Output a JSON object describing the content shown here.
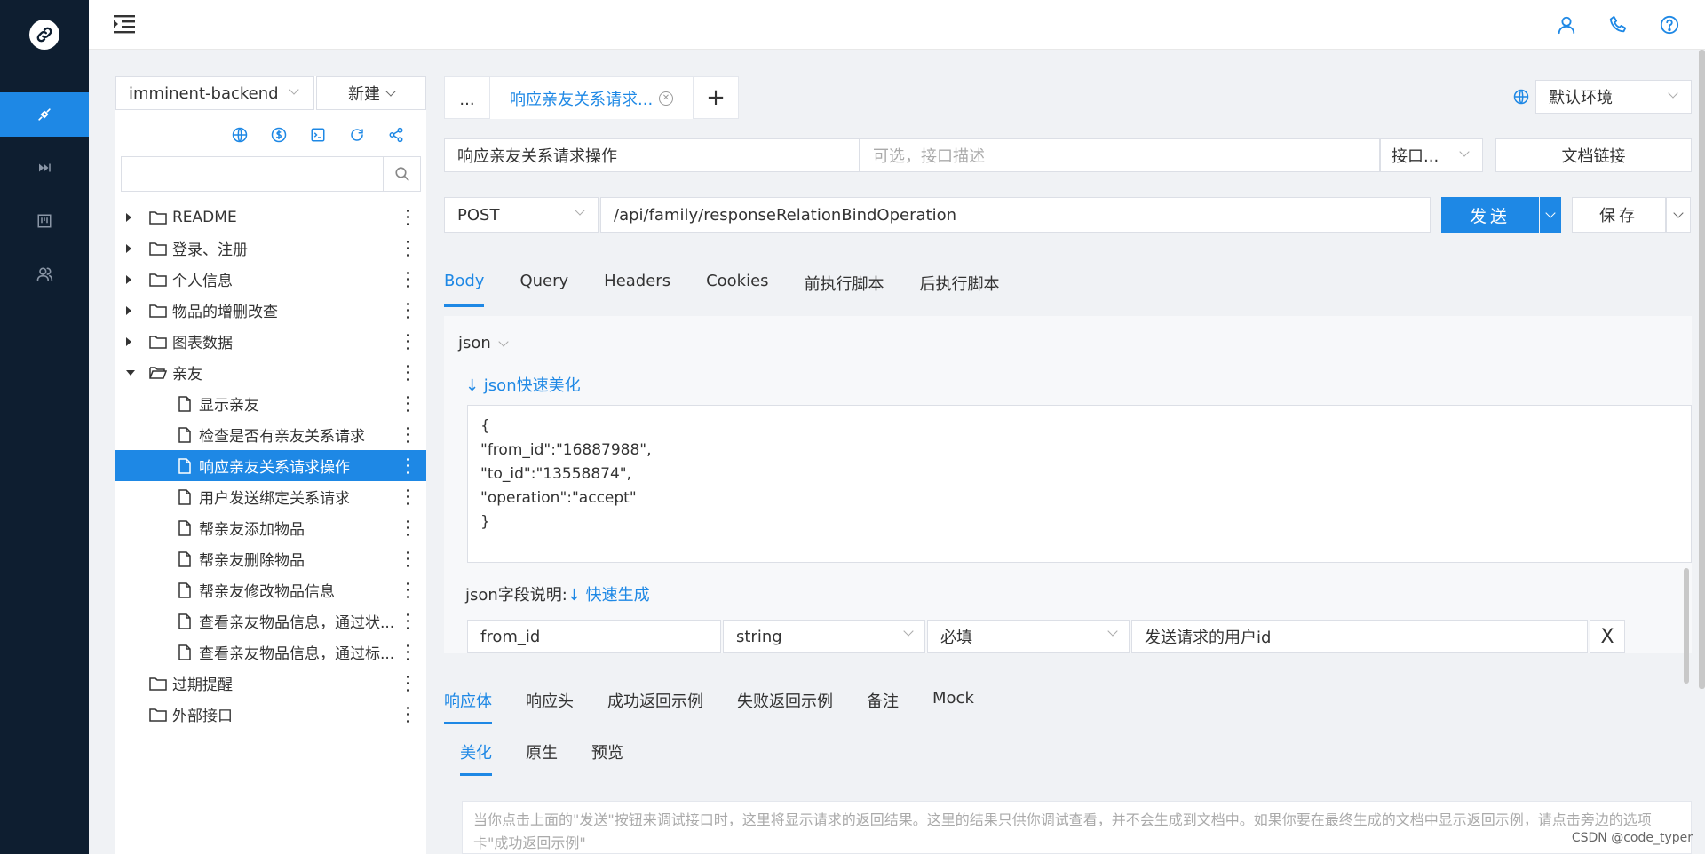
{
  "rail": {
    "items": [
      {
        "name": "link-logo-icon"
      },
      {
        "name": "api-icon",
        "active": true
      },
      {
        "name": "skip-icon"
      },
      {
        "name": "board-icon"
      },
      {
        "name": "team-icon"
      }
    ]
  },
  "topbar": {
    "icons": [
      "user-icon",
      "phone-icon",
      "help-icon"
    ]
  },
  "sidebar": {
    "project": "imminent-backend",
    "new_label": "新建",
    "tools": [
      "globe-icon",
      "dollar-icon",
      "terminal-icon",
      "refresh-icon",
      "share-icon"
    ],
    "search_placeholder": "",
    "tree": [
      {
        "label": "README",
        "type": "folder",
        "level": 0,
        "expand": "collapsed"
      },
      {
        "label": "登录、注册",
        "type": "folder",
        "level": 0,
        "expand": "collapsed"
      },
      {
        "label": "个人信息",
        "type": "folder",
        "level": 0,
        "expand": "collapsed"
      },
      {
        "label": "物品的增删改查",
        "type": "folder",
        "level": 0,
        "expand": "collapsed"
      },
      {
        "label": "图表数据",
        "type": "folder",
        "level": 0,
        "expand": "collapsed"
      },
      {
        "label": "亲友",
        "type": "folder-open",
        "level": 0,
        "expand": "expanded"
      },
      {
        "label": "显示亲友",
        "type": "file",
        "level": 1
      },
      {
        "label": "检查是否有亲友关系请求",
        "type": "file",
        "level": 1
      },
      {
        "label": "响应亲友关系请求操作",
        "type": "file",
        "level": 1,
        "active": true
      },
      {
        "label": "用户发送绑定关系请求",
        "type": "file",
        "level": 1
      },
      {
        "label": "帮亲友添加物品",
        "type": "file",
        "level": 1
      },
      {
        "label": "帮亲友删除物品",
        "type": "file",
        "level": 1
      },
      {
        "label": "帮亲友修改物品信息",
        "type": "file",
        "level": 1
      },
      {
        "label": "查看亲友物品信息，通过状...",
        "type": "file",
        "level": 1
      },
      {
        "label": "查看亲友物品信息，通过标...",
        "type": "file",
        "level": 1
      },
      {
        "label": "过期提醒",
        "type": "folder",
        "level": 0,
        "expand": "none"
      },
      {
        "label": "外部接口",
        "type": "folder",
        "level": 0,
        "expand": "none"
      }
    ]
  },
  "tabs": {
    "more_label": "...",
    "active_label": "响应亲友关系请求...",
    "add_label": "+"
  },
  "env": {
    "selected": "默认环境"
  },
  "api": {
    "name": "响应亲友关系请求操作",
    "desc_placeholder": "可选，接口描述",
    "status_select": "接口...",
    "doc_link_label": "文档链接",
    "method": "POST",
    "url": "/api/family/responseRelationBindOperation",
    "send_label": "发送",
    "save_label": "保存"
  },
  "request_tabs": [
    "Body",
    "Query",
    "Headers",
    "Cookies",
    "前执行脚本",
    "后执行脚本"
  ],
  "body": {
    "format": "json",
    "beautify_label": "↓ json快速美化",
    "json_lines": [
      "{",
      "\"from_id\":\"16887988\",",
      "\"to_id\":\"13558874\",",
      "\"operation\":\"accept\"",
      "}"
    ],
    "field_desc_label": "json字段说明:",
    "quick_gen_label": "↓ 快速生成",
    "param": {
      "name": "from_id",
      "type": "string",
      "required": "必填",
      "desc": "发送请求的用户id",
      "delete_label": "X"
    }
  },
  "response_tabs": [
    "响应体",
    "响应头",
    "成功返回示例",
    "失败返回示例",
    "备注",
    "Mock"
  ],
  "response_sub_tabs": [
    "美化",
    "原生",
    "预览"
  ],
  "response_hint": "当你点击上面的\"发送\"按钮来调试接口时，这里将显示请求的返回结果。这里的结果只供你调试查看，并不会生成到文档中。如果你要在最终生成的文档中显示返回示例，请点击旁边的选项卡\"成功返回示例\"",
  "watermark": "CSDN @code_typer",
  "colors": {
    "accent": "#1e88e5",
    "rail_bg": "#0e1e30"
  }
}
